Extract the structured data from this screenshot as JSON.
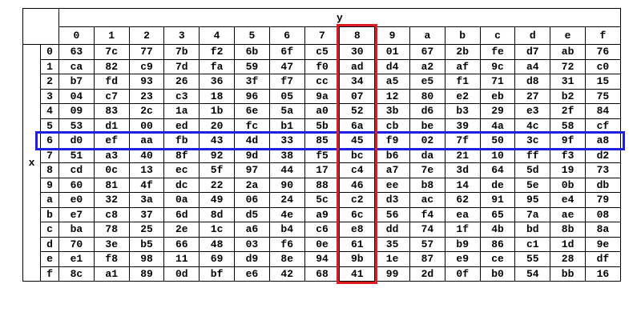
{
  "table": {
    "x_label": "x",
    "y_label": "y",
    "col_headers": [
      "0",
      "1",
      "2",
      "3",
      "4",
      "5",
      "6",
      "7",
      "8",
      "9",
      "a",
      "b",
      "c",
      "d",
      "e",
      "f"
    ],
    "row_headers": [
      "0",
      "1",
      "2",
      "3",
      "4",
      "5",
      "6",
      "7",
      "8",
      "9",
      "a",
      "b",
      "c",
      "d",
      "e",
      "f"
    ],
    "rows": [
      [
        "63",
        "7c",
        "77",
        "7b",
        "f2",
        "6b",
        "6f",
        "c5",
        "30",
        "01",
        "67",
        "2b",
        "fe",
        "d7",
        "ab",
        "76"
      ],
      [
        "ca",
        "82",
        "c9",
        "7d",
        "fa",
        "59",
        "47",
        "f0",
        "ad",
        "d4",
        "a2",
        "af",
        "9c",
        "a4",
        "72",
        "c0"
      ],
      [
        "b7",
        "fd",
        "93",
        "26",
        "36",
        "3f",
        "f7",
        "cc",
        "34",
        "a5",
        "e5",
        "f1",
        "71",
        "d8",
        "31",
        "15"
      ],
      [
        "04",
        "c7",
        "23",
        "c3",
        "18",
        "96",
        "05",
        "9a",
        "07",
        "12",
        "80",
        "e2",
        "eb",
        "27",
        "b2",
        "75"
      ],
      [
        "09",
        "83",
        "2c",
        "1a",
        "1b",
        "6e",
        "5a",
        "a0",
        "52",
        "3b",
        "d6",
        "b3",
        "29",
        "e3",
        "2f",
        "84"
      ],
      [
        "53",
        "d1",
        "00",
        "ed",
        "20",
        "fc",
        "b1",
        "5b",
        "6a",
        "cb",
        "be",
        "39",
        "4a",
        "4c",
        "58",
        "cf"
      ],
      [
        "d0",
        "ef",
        "aa",
        "fb",
        "43",
        "4d",
        "33",
        "85",
        "45",
        "f9",
        "02",
        "7f",
        "50",
        "3c",
        "9f",
        "a8"
      ],
      [
        "51",
        "a3",
        "40",
        "8f",
        "92",
        "9d",
        "38",
        "f5",
        "bc",
        "b6",
        "da",
        "21",
        "10",
        "ff",
        "f3",
        "d2"
      ],
      [
        "cd",
        "0c",
        "13",
        "ec",
        "5f",
        "97",
        "44",
        "17",
        "c4",
        "a7",
        "7e",
        "3d",
        "64",
        "5d",
        "19",
        "73"
      ],
      [
        "60",
        "81",
        "4f",
        "dc",
        "22",
        "2a",
        "90",
        "88",
        "46",
        "ee",
        "b8",
        "14",
        "de",
        "5e",
        "0b",
        "db"
      ],
      [
        "e0",
        "32",
        "3a",
        "0a",
        "49",
        "06",
        "24",
        "5c",
        "c2",
        "d3",
        "ac",
        "62",
        "91",
        "95",
        "e4",
        "79"
      ],
      [
        "e7",
        "c8",
        "37",
        "6d",
        "8d",
        "d5",
        "4e",
        "a9",
        "6c",
        "56",
        "f4",
        "ea",
        "65",
        "7a",
        "ae",
        "08"
      ],
      [
        "ba",
        "78",
        "25",
        "2e",
        "1c",
        "a6",
        "b4",
        "c6",
        "e8",
        "dd",
        "74",
        "1f",
        "4b",
        "bd",
        "8b",
        "8a"
      ],
      [
        "70",
        "3e",
        "b5",
        "66",
        "48",
        "03",
        "f6",
        "0e",
        "61",
        "35",
        "57",
        "b9",
        "86",
        "c1",
        "1d",
        "9e"
      ],
      [
        "e1",
        "f8",
        "98",
        "11",
        "69",
        "d9",
        "8e",
        "94",
        "9b",
        "1e",
        "87",
        "e9",
        "ce",
        "55",
        "28",
        "df"
      ],
      [
        "8c",
        "a1",
        "89",
        "0d",
        "bf",
        "e6",
        "42",
        "68",
        "41",
        "99",
        "2d",
        "0f",
        "b0",
        "54",
        "bb",
        "16"
      ]
    ],
    "highlight": {
      "row_index": 6,
      "row_color": "#1f1fe0",
      "column_index": 8,
      "column_color": "#e01b1b"
    }
  }
}
